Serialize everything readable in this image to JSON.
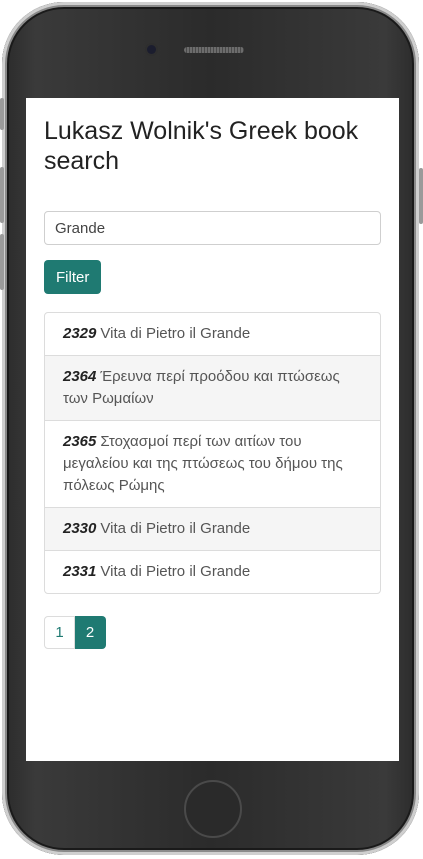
{
  "page": {
    "title": "Lukasz Wolnik's Greek book search"
  },
  "search": {
    "value": "Grande"
  },
  "filter_button": {
    "label": "Filter"
  },
  "results": [
    {
      "id": "2329",
      "title": "Vita di Pietro il Grande"
    },
    {
      "id": "2364",
      "title": "Έρευνα περί προόδου και πτώσεως των Ρωμαίων"
    },
    {
      "id": "2365",
      "title": "Στοχασμοί περί των αιτίων του μεγαλείου και της πτώσεως του δήμου της πόλεως Ρώμης"
    },
    {
      "id": "2330",
      "title": "Vita di Pietro il Grande"
    },
    {
      "id": "2331",
      "title": "Vita di Pietro il Grande"
    }
  ],
  "pagination": {
    "pages": [
      "1",
      "2"
    ],
    "current": "2"
  },
  "colors": {
    "accent": "#1f7a72"
  }
}
